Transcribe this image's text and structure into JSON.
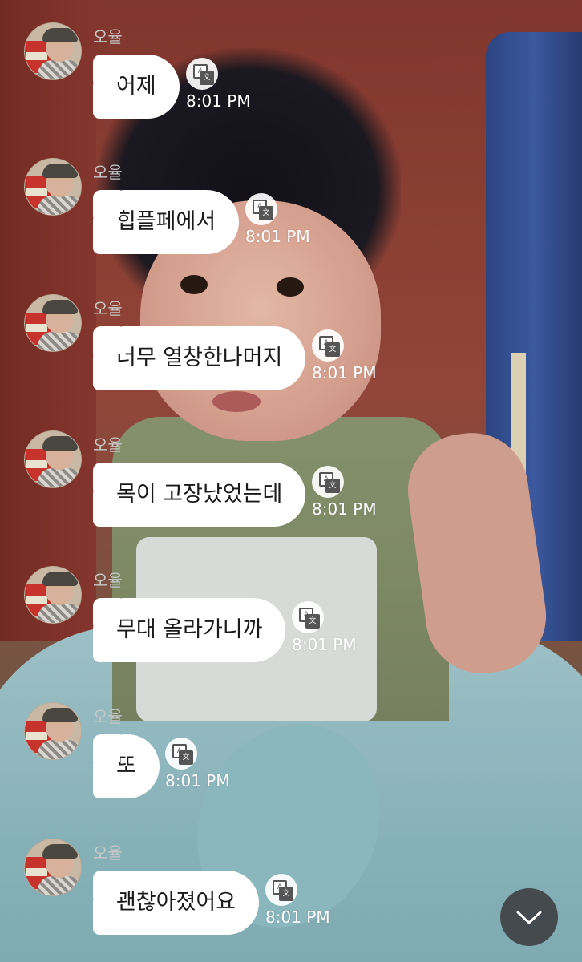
{
  "sender": {
    "name": "오율",
    "avatar": "profile-photo"
  },
  "icons": {
    "translate": "translate-icon",
    "scroll": "chevron-down-icon"
  },
  "messages": [
    {
      "text": "어제",
      "time": "8:01 PM"
    },
    {
      "text": "힙플페에서",
      "time": "8:01 PM"
    },
    {
      "text": "너무 열창한나머지",
      "time": "8:01 PM"
    },
    {
      "text": "목이 고장났었는데",
      "time": "8:01 PM"
    },
    {
      "text": "무대 올라가니까",
      "time": "8:01 PM"
    },
    {
      "text": "또",
      "time": "8:01 PM"
    },
    {
      "text": "괜찮아졌어요",
      "time": "8:01 PM"
    }
  ]
}
